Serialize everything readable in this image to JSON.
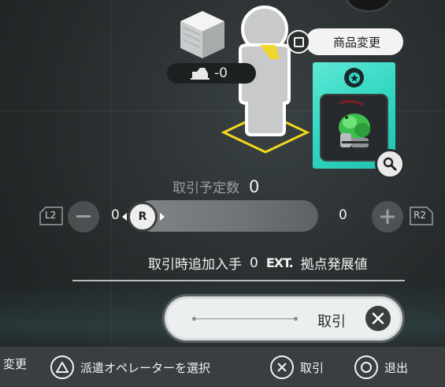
{
  "header": {
    "change_product_label": "商品変更"
  },
  "resource_badge": {
    "value": "-0",
    "icon": "truck-icon"
  },
  "item_card": {
    "rarity_icon": "star-badge-icon",
    "item_icon": "green-item-icon",
    "zoom_icon": "magnifier-icon"
  },
  "trade": {
    "count_label": "取引予定数",
    "count_value": "0",
    "slider": {
      "left_trigger": "L2",
      "right_trigger": "R2",
      "knob_label": "R",
      "min_value": "0",
      "max_value": "0"
    },
    "bonus_label": "取引時追加入手",
    "bonus_value": "0",
    "bonus_unit_logo": "EXT.",
    "bonus_unit_label": "拠点発展値",
    "button_label": "取引"
  },
  "footer": {
    "change_label": "変更",
    "select_operator_label": "派遣オペレーターを選択",
    "trade_label": "取引",
    "exit_label": "退出"
  },
  "colors": {
    "card_teal": "#33d8c3",
    "selection_yellow": "#f3d81c"
  }
}
